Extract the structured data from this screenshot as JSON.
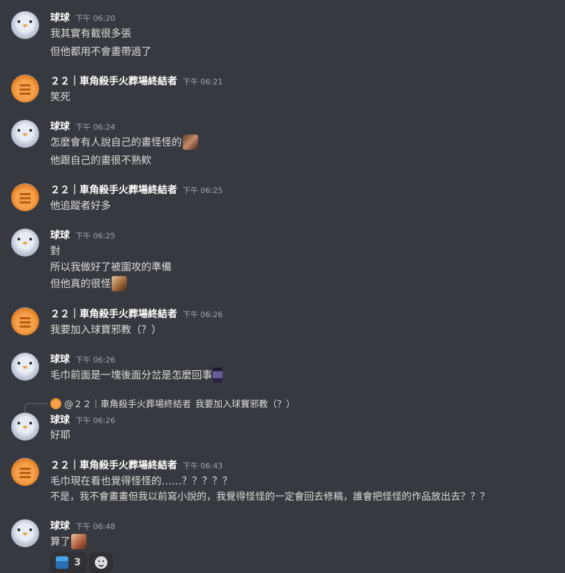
{
  "messages": [
    {
      "author": "球球",
      "time": "下午 06:20",
      "avatar": "bird",
      "lines": [
        "我其實有截很多張",
        "但他都用不會畫帶過了"
      ]
    },
    {
      "author": "２２｜車角殺手火葬場終結者",
      "time": "下午 06:21",
      "avatar": "cat",
      "lines": [
        "笑死"
      ]
    },
    {
      "author": "球球",
      "time": "下午 06:24",
      "avatar": "bird",
      "lines": [
        "怎麼會有人說自己的畫怪怪的",
        "他跟自己的畫很不熟欸"
      ]
    },
    {
      "author": "２２｜車角殺手火葬場終結者",
      "time": "下午 06:25",
      "avatar": "cat",
      "lines": [
        "他追蹤者好多"
      ]
    },
    {
      "author": "球球",
      "time": "下午 06:25",
      "avatar": "bird",
      "lines": [
        "對",
        "所以我做好了被圍攻的準備",
        "但他真的很怪"
      ]
    },
    {
      "author": "２２｜車角殺手火葬場終結者",
      "time": "下午 06:26",
      "avatar": "cat",
      "lines": [
        "我要加入球寶邪教（？）"
      ]
    },
    {
      "author": "球球",
      "time": "下午 06:26",
      "avatar": "bird",
      "lines": [
        "毛巾前面是一塊後面分岔是怎麼回事"
      ]
    },
    {
      "author": "球球",
      "time": "下午 06:26",
      "avatar": "bird",
      "lines": [
        "好耶"
      ]
    },
    {
      "author": "２２｜車角殺手火葬場終結者",
      "time": "下午 06:43",
      "avatar": "cat",
      "lines": [
        "毛巾現在看也覺得怪怪的……？？？？？",
        "不是，我不會畫畫但我以前寫小說的，我覺得怪怪的一定會回去修稿，誰會把怪怪的作品放出去？？？"
      ]
    },
    {
      "author": "球球",
      "time": "下午 06:48",
      "avatar": "bird",
      "lines": [
        "算了"
      ]
    }
  ],
  "reply": {
    "mention": "@２２｜車角殺手火葬場終結者",
    "text": "我要加入球寶邪教（？）"
  },
  "reactions": [
    {
      "emoji": "blue-character-emoji",
      "count": "3"
    },
    {
      "emoji": "add-reaction-icon"
    }
  ]
}
